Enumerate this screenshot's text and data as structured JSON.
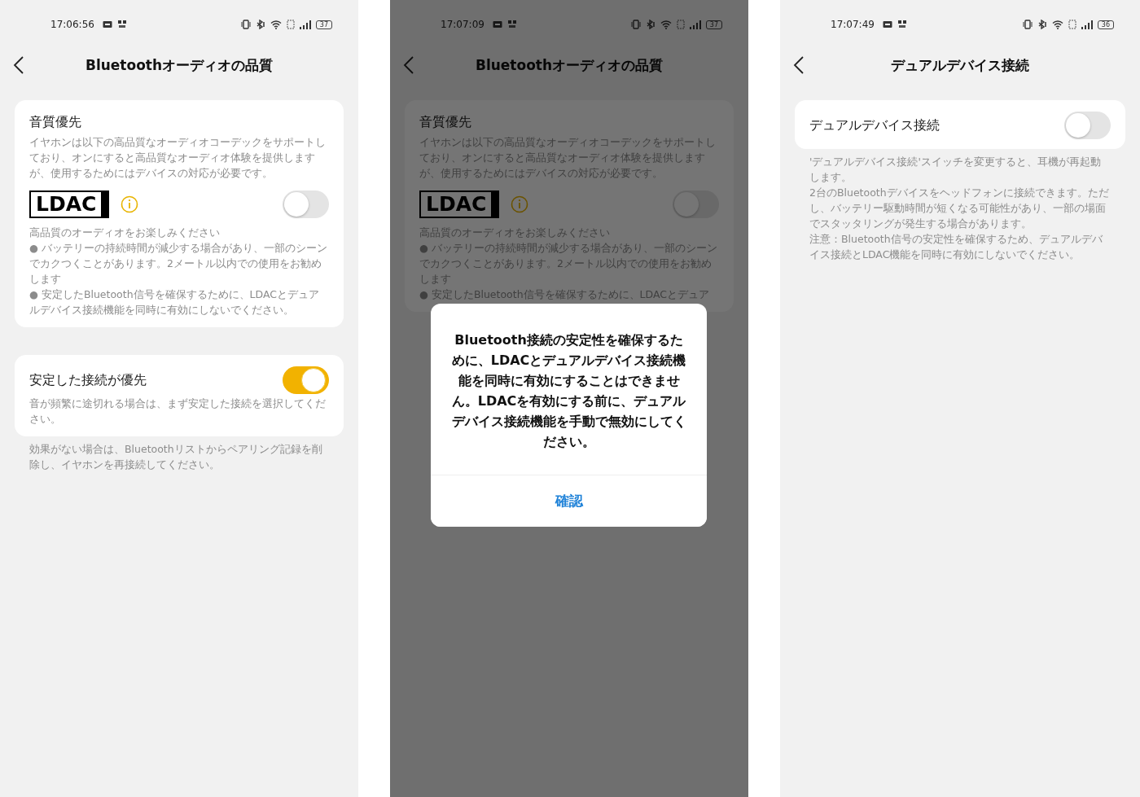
{
  "screens": [
    {
      "status_bar": {
        "time": "17:06:56",
        "battery": "37"
      },
      "title": "Bluetoothオーディオの品質",
      "cards": [
        {
          "title": "音質優先",
          "description": "イヤホンは以下の高品質なオーディオコーデックをサポートしており、オンにすると高品質なオーディオ体験を提供しますが、使用するためにはデバイスの対応が必要です。",
          "codec": {
            "logo": "LDAC",
            "toggle": {
              "on": false
            }
          },
          "subtitle": "高品質のオーディオをお楽しみください",
          "bullets": [
            "● バッテリーの持続時間が減少する場合があり、一部のシーンでカクつくことがあります。2メートル以内での使用をお勧めします",
            "● 安定したBluetooth信号を確保するために、LDACとデュアルデバイス接続機能を同時に有効にしないでください。"
          ]
        },
        {
          "title": "安定した接続が優先",
          "toggle": {
            "on": true
          },
          "description": "音が頻繁に途切れる場合は、まず安定した接続を選択してください。"
        }
      ],
      "notes": [
        "効果がない場合は、Bluetoothリストからペアリング記録を削除し、イヤホンを再接続してください。"
      ]
    },
    {
      "status_bar": {
        "time": "17:07:09",
        "battery": "37"
      },
      "title": "Bluetoothオーディオの品質",
      "cards": [
        {
          "title": "音質優先",
          "description": "イヤホンは以下の高品質なオーディオコーデックをサポートしており、オンにすると高品質なオーディオ体験を提供しますが、使用するためにはデバイスの対応が必要です。",
          "codec": {
            "logo": "LDAC",
            "toggle": {
              "on": false
            }
          },
          "subtitle": "高品質のオーディオをお楽しみください",
          "bullets": [
            "● バッテリーの持続時間が減少する場合があり、一部のシーンでカクつくことがあります。2メートル以内での使用をお勧めします",
            "● 安定したBluetooth信号を確保するために、LDACとデュア"
          ]
        }
      ],
      "dialog": {
        "message": "Bluetooth接続の安定性を確保するために、LDACとデュアルデバイス接続機能を同時に有効にすることはできません。LDACを有効にする前に、デュアルデバイス接続機能を手動で無効にしてください。",
        "button": "確認"
      }
    },
    {
      "status_bar": {
        "time": "17:07:49",
        "battery": "36"
      },
      "title": "デュアルデバイス接続",
      "cards": [
        {
          "title": "デュアルデバイス接続",
          "toggle": {
            "on": false
          }
        }
      ],
      "notes": [
        "'デュアルデバイス接続'スイッチを変更すると、耳機が再起動します。",
        "2台のBluetoothデバイスをヘッドフォンに接続できます。ただし、バッテリー駆動時間が短くなる可能性があり、一部の場面でスタッタリングが発生する場合があります。",
        "注意：Bluetooth信号の安定性を確保するため、デュアルデバイス接続とLDAC機能を同時に有効にしないでください。"
      ]
    }
  ]
}
